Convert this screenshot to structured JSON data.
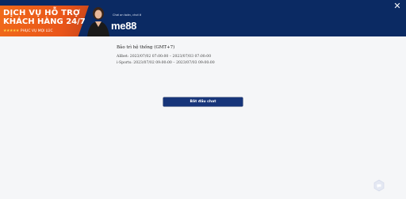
{
  "header": {
    "close_label": "✕"
  },
  "banner": {
    "line1": "DỊCH VỤ HỖ TRỢ",
    "line2": "KHÁCH HÀNG 24/7",
    "stars": "★★★★★",
    "line3": "PHỤC VỤ MỌI LÚC",
    "tagline": "Chơi an toàn, chơi ở",
    "logo": "me88",
    "brand_orange": "#e9551a",
    "brand_navy": "#0b2a63"
  },
  "notice": {
    "title": "Bảo trì hệ thống (GMT+7)",
    "items": [
      "Allbet: 2023/07/02 07:00:00 – 2023/07/03 07:00:00",
      "i-Sports: 2023/07/02 09:00:00 – 2023/07/03 09:00:00"
    ]
  },
  "actions": {
    "start_chat_label": "Bắt đầu chat"
  },
  "widget": {
    "icon": "chat-widget-icon"
  }
}
